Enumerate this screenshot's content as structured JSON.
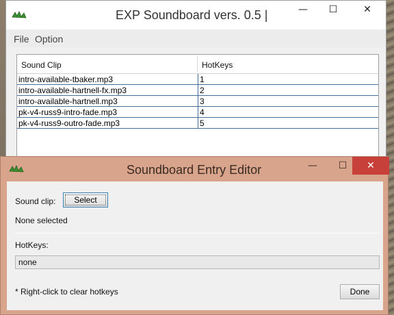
{
  "main_window": {
    "title": "EXP Soundboard vers. 0.5 |",
    "caption_buttons": {
      "minimize": "—",
      "maximize": "☐",
      "close": "✕"
    },
    "menu": {
      "file": "File",
      "option": "Option"
    },
    "table": {
      "headers": {
        "sound_clip": "Sound Clip",
        "hotkeys": "HotKeys"
      },
      "rows": [
        {
          "clip": "intro-available-tbaker.mp3",
          "hotkey": "1"
        },
        {
          "clip": "intro-available-hartnell-fx.mp3",
          "hotkey": "2"
        },
        {
          "clip": "intro-available-hartnell.mp3",
          "hotkey": "3"
        },
        {
          "clip": "pk-v4-russ9-intro-fade.mp3",
          "hotkey": "4"
        },
        {
          "clip": "pk-v4-russ9-outro-fade.mp3",
          "hotkey": "5"
        }
      ]
    }
  },
  "editor_window": {
    "title": "Soundboard Entry Editor",
    "caption_buttons": {
      "minimize": "—",
      "maximize": "☐",
      "close": "✕"
    },
    "sound_clip_label": "Sound clip:",
    "select_button": "Select",
    "selection_status": "None selected",
    "hotkeys_label": "HotKeys:",
    "hotkeys_value": "none",
    "hint": "* Right-click to clear hotkeys",
    "done_button": "Done"
  },
  "colors": {
    "editor_frame": "#d9a48c",
    "close_button": "#c7403a",
    "row_grid": "#4a6d94"
  }
}
